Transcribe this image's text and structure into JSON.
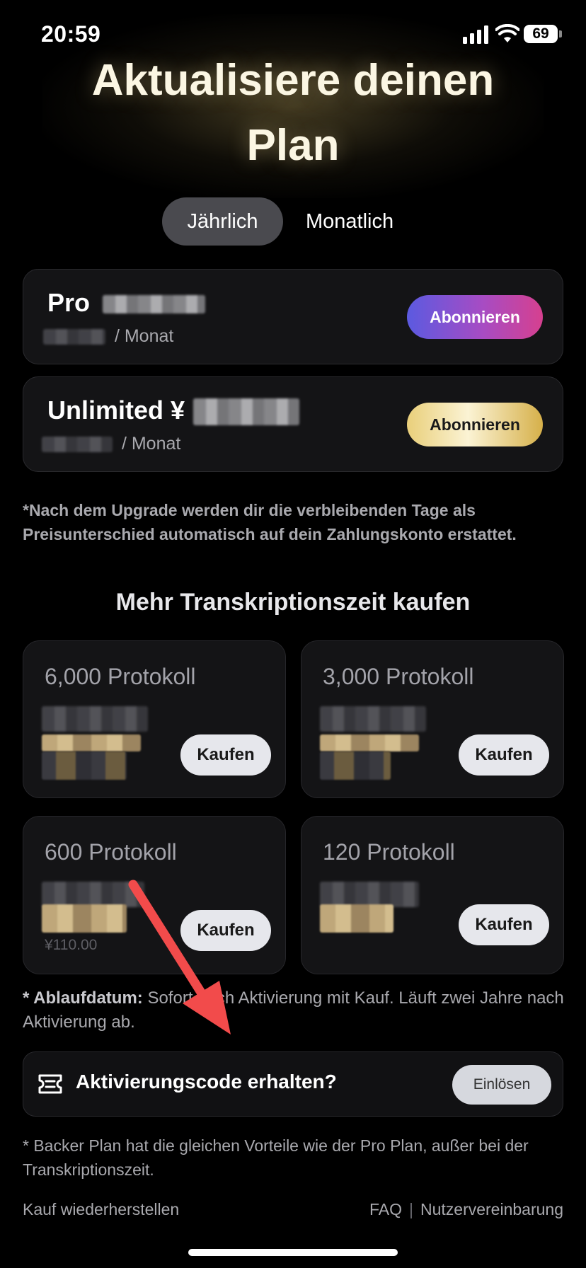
{
  "status_bar": {
    "time": "20:59",
    "battery": "69"
  },
  "header": {
    "title_line1": "Aktualisiere deinen",
    "title_line2": "Plan"
  },
  "billing_toggle": {
    "yearly": "Jährlich",
    "monthly": "Monatlich",
    "selected": "Jährlich"
  },
  "plans": [
    {
      "name": "Pro",
      "per_month": "/ Monat",
      "button": "Abonnieren"
    },
    {
      "name": "Unlimited ¥",
      "per_month": "/ Monat",
      "button": "Abonnieren"
    }
  ],
  "upgrade_note": "*Nach dem Upgrade werden dir die verbleibenden Tage als Preisunterschied automatisch auf dein Zahlungskonto erstattet.",
  "more_time": {
    "title": "Mehr Transkriptionszeit kaufen",
    "packs": [
      {
        "name": "6,000 Protokoll",
        "button": "Kaufen"
      },
      {
        "name": "3,000 Protokoll",
        "button": "Kaufen"
      },
      {
        "name": "600 Protokoll",
        "button": "Kaufen",
        "old_price": "¥110.00"
      },
      {
        "name": "120 Protokoll",
        "button": "Kaufen"
      }
    ]
  },
  "expiry": {
    "label": "* Ablaufdatum:",
    "text": " Sofort nach Aktivierung mit Kauf. Läuft zwei Jahre nach Aktivierung ab."
  },
  "activation": {
    "text": "Aktivierungscode erhalten?",
    "button": "Einlösen",
    "icon": "ticket-icon"
  },
  "backer_note": "* Backer Plan hat die gleichen Vorteile wie der Pro Plan, außer bei der Transkriptionszeit.",
  "footer": {
    "restore": "Kauf wiederherstellen",
    "faq": "FAQ",
    "separator": "|",
    "terms": "Nutzervereinbarung"
  },
  "colors": {
    "background": "#000000",
    "pro_gradient_start": "#5b5ae0",
    "pro_gradient_end": "#d6408f",
    "gold": "#e9cf7a",
    "arrow": "#f24b4b"
  }
}
